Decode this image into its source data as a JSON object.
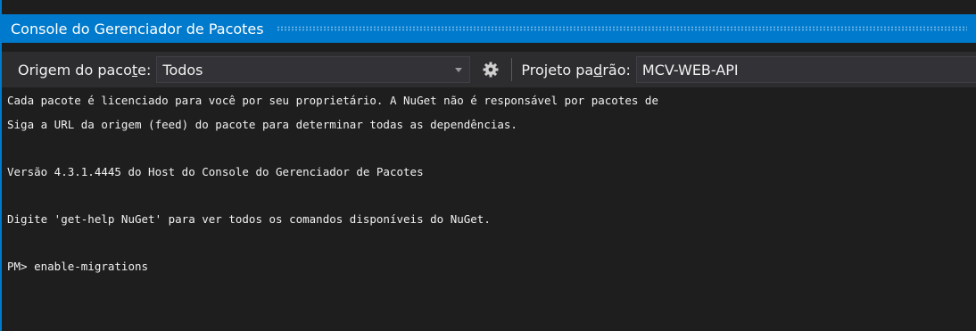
{
  "window": {
    "title": "Console do Gerenciador de Pacotes"
  },
  "toolbar": {
    "package_source_label_prefix": "Origem do paco",
    "package_source_label_access": "t",
    "package_source_label_suffix": "e:",
    "package_source_value": "Todos",
    "settings_icon": "gear-icon",
    "default_project_label_prefix": "Projeto pa",
    "default_project_label_access": "d",
    "default_project_label_suffix": "rão:",
    "default_project_value": "MCV-WEB-API"
  },
  "console": {
    "lines": [
      "Cada pacote é licenciado para você por seu proprietário. A NuGet não é responsável por pacotes de",
      "Siga a URL da origem (feed) do pacote para determinar todas as dependências.",
      "",
      "Versão 4.3.1.4445 do Host do Console do Gerenciador de Pacotes",
      "",
      "Digite 'get-help NuGet' para ver todos os comandos disponíveis do NuGet.",
      "",
      "PM> enable-migrations"
    ]
  },
  "colors": {
    "title_bar": "#007acc",
    "toolbar_bg": "#2d2d30",
    "console_bg": "#1e1e1e",
    "text": "#f1f1f1"
  }
}
